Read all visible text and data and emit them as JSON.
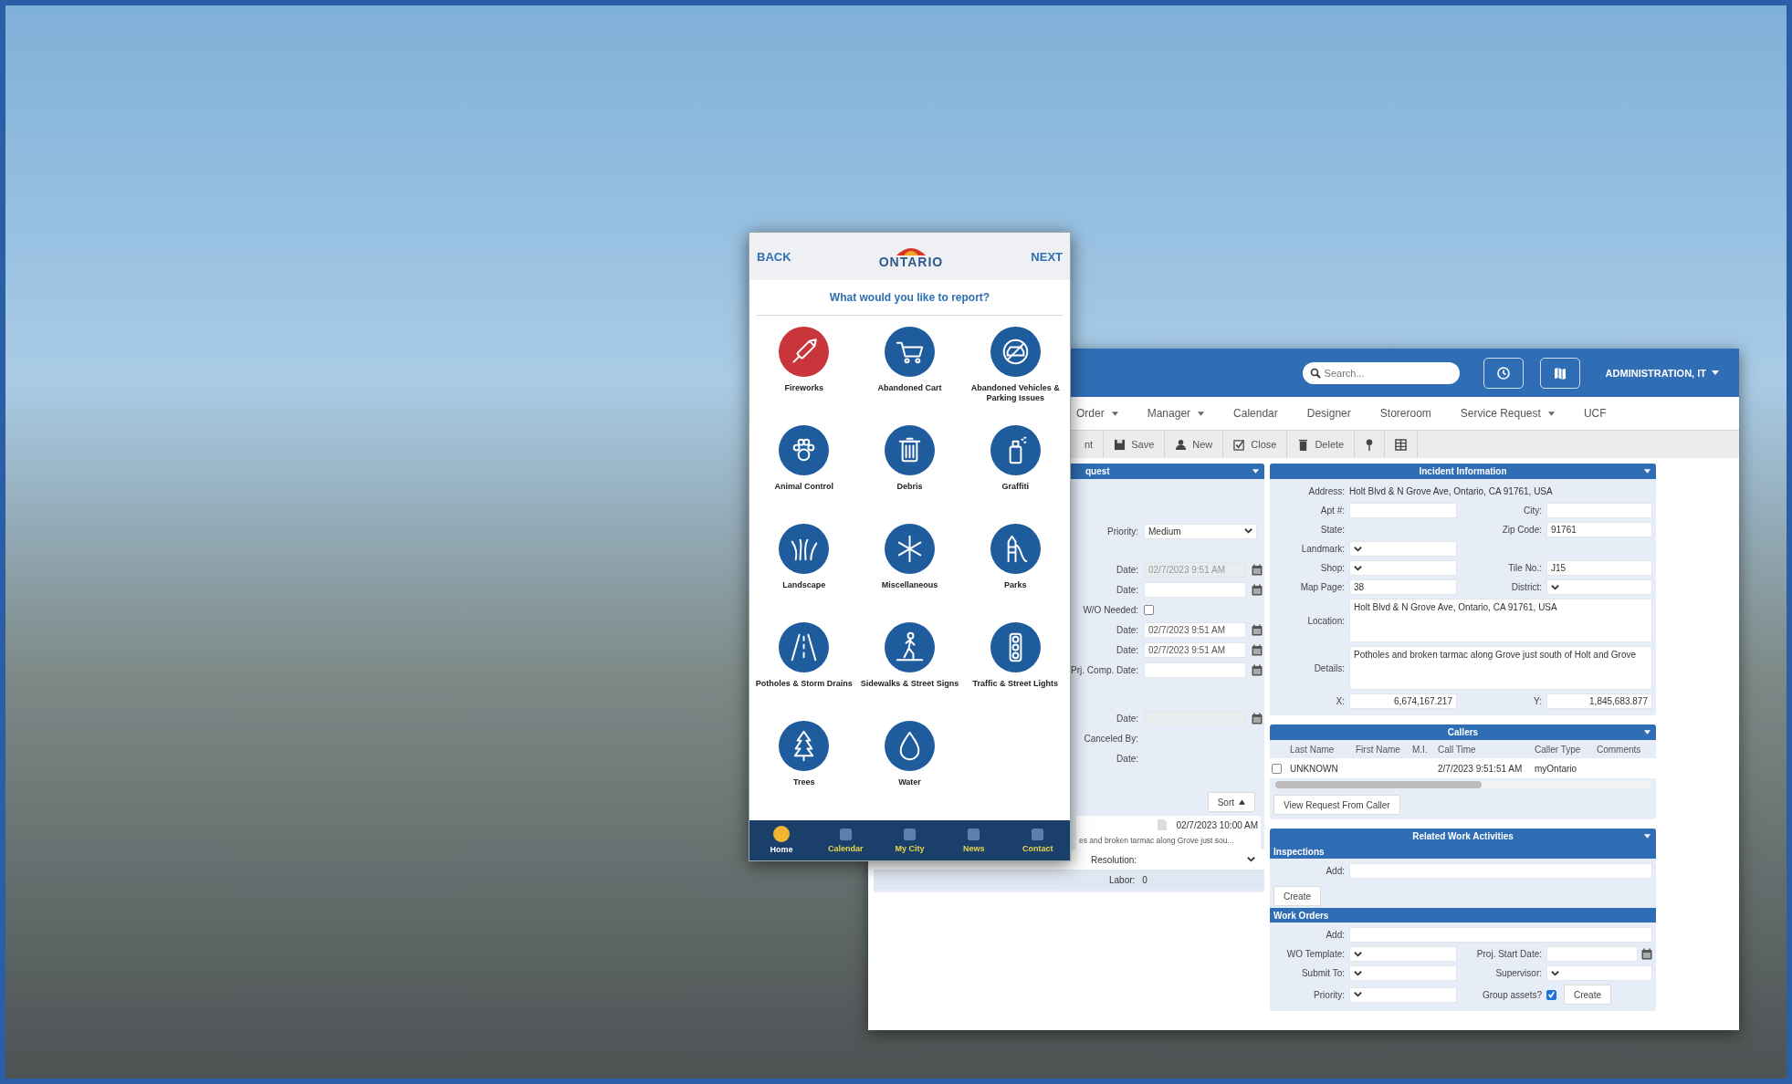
{
  "phone": {
    "back": "BACK",
    "logo": "ONTARIO",
    "next": "NEXT",
    "prompt": "What would you like to report?",
    "categories": [
      {
        "label": "Fireworks",
        "color": "#c8353a"
      },
      {
        "label": "Abandoned Cart",
        "color": "#1f5c9e"
      },
      {
        "label": "Abandoned Vehicles & Parking Issues",
        "color": "#1f5c9e"
      },
      {
        "label": "Animal Control",
        "color": "#1f5c9e"
      },
      {
        "label": "Debris",
        "color": "#1f5c9e"
      },
      {
        "label": "Graffiti",
        "color": "#1f5c9e"
      },
      {
        "label": "Landscape",
        "color": "#1f5c9e"
      },
      {
        "label": "Miscellaneous",
        "color": "#1f5c9e"
      },
      {
        "label": "Parks",
        "color": "#1f5c9e"
      },
      {
        "label": "Potholes & Storm Drains",
        "color": "#1f5c9e"
      },
      {
        "label": "Sidewalks & Street Signs",
        "color": "#1f5c9e"
      },
      {
        "label": "Traffic & Street Lights",
        "color": "#1f5c9e"
      },
      {
        "label": "Trees",
        "color": "#1f5c9e"
      },
      {
        "label": "Water",
        "color": "#1f5c9e"
      }
    ],
    "tabs": [
      {
        "label": "Home",
        "selected": true
      },
      {
        "label": "Calendar",
        "selected": false
      },
      {
        "label": "My City",
        "selected": false
      },
      {
        "label": "News",
        "selected": false
      },
      {
        "label": "Contact",
        "selected": false
      }
    ]
  },
  "app": {
    "search": {
      "placeholder": "Search..."
    },
    "user": "ADMINISTRATION, IT",
    "nav": [
      {
        "label": "Order",
        "dropdown": true
      },
      {
        "label": "Manager",
        "dropdown": true
      },
      {
        "label": "Calendar",
        "dropdown": false
      },
      {
        "label": "Designer",
        "dropdown": false
      },
      {
        "label": "Storeroom",
        "dropdown": false
      },
      {
        "label": "Service Request",
        "dropdown": true
      },
      {
        "label": "UCF",
        "dropdown": false
      }
    ],
    "toolbar": [
      "nt",
      "Save",
      "New",
      "Close",
      "Delete"
    ],
    "request": {
      "title": "quest",
      "groups": [
        [
          {
            "kind": "select",
            "label": "Priority:",
            "value": "Medium"
          }
        ],
        [
          {
            "kind": "date",
            "label": "Date:",
            "value": "02/7/2023 9:51 AM",
            "disabled": true
          },
          {
            "kind": "date",
            "label": "Date:",
            "disabled": false
          },
          {
            "kind": "checkbox",
            "label": "W/O Needed:",
            "checked": false
          },
          {
            "kind": "date",
            "label": "Date:",
            "value": "02/7/2023 9:51 AM",
            "disabled": false
          },
          {
            "kind": "date",
            "label": "Date:",
            "value": "02/7/2023 9:51 AM",
            "disabled": false
          },
          {
            "kind": "date",
            "label": "Prj. Comp. Date:",
            "disabled": false
          }
        ],
        [
          {
            "kind": "date",
            "label": "Date:",
            "disabled": true
          },
          {
            "kind": "text",
            "label": "Canceled By:"
          },
          {
            "kind": "text",
            "label": "Date:"
          }
        ]
      ],
      "sort": "Sort",
      "note": {
        "date": "02/7/2023 10:00 AM",
        "text": "es and broken tarmac along Grove just sou..."
      },
      "resolution": "Resolution:",
      "labor": {
        "label": "Labor:",
        "value": "0"
      }
    },
    "incident": {
      "title": "Incident Information",
      "rows": [
        [
          {
            "kind": "text",
            "label": "Address:",
            "value": "Holt Blvd & N Grove Ave, Ontario, CA 91761, USA"
          }
        ],
        [
          {
            "kind": "input",
            "label": "Apt #:"
          },
          {
            "kind": "input",
            "label": "City:"
          }
        ],
        [
          {
            "kind": "text",
            "label": "State:"
          },
          {
            "kind": "input",
            "label": "Zip Code:",
            "value": "91761"
          }
        ],
        [
          {
            "kind": "select",
            "label": "Landmark:"
          }
        ],
        [
          {
            "kind": "select",
            "label": "Shop:"
          },
          {
            "kind": "input",
            "label": "Tile No.:",
            "value": "J15"
          }
        ],
        [
          {
            "kind": "input",
            "label": "Map Page:",
            "value": "38"
          },
          {
            "kind": "select",
            "label": "District:"
          }
        ],
        [
          {
            "kind": "textarea",
            "label": "Location:",
            "value": "Holt Blvd & N Grove Ave, Ontario, CA 91761, USA"
          }
        ],
        [
          {
            "kind": "textarea",
            "label": "Details:",
            "value": "Potholes and broken tarmac along Grove just south of Holt and Grove"
          }
        ],
        [
          {
            "kind": "number",
            "label": "X:",
            "value": "6,674,167.217"
          },
          {
            "kind": "number",
            "label": "Y:",
            "value": "1,845,683.877"
          }
        ]
      ]
    },
    "callers": {
      "title": "Callers",
      "columns": [
        "Last Name",
        "First Name",
        "M.I.",
        "Call Time",
        "Caller Type",
        "Comments"
      ],
      "rows": [
        {
          "checked": false,
          "cells": [
            "UNKNOWN",
            null,
            null,
            "2/7/2023 9:51:51 AM",
            "myOntario",
            null
          ]
        }
      ],
      "button": "View Request From Caller"
    },
    "related": {
      "title": "Related Work Activities",
      "inspections": {
        "title": "Inspections",
        "add": "Add:",
        "button": "Create"
      },
      "work_orders": {
        "title": "Work Orders",
        "add": "Add:",
        "rows": [
          [
            {
              "kind": "select",
              "label": "WO Template:"
            },
            {
              "kind": "date",
              "label": "Proj. Start Date:"
            }
          ],
          [
            {
              "kind": "select",
              "label": "Submit To:"
            },
            {
              "kind": "select",
              "label": "Supervisor:"
            }
          ],
          [
            {
              "kind": "select",
              "label": "Priority:"
            },
            {
              "kind": "checkbox",
              "label": "Group assets?",
              "checked": true,
              "button": "Create"
            }
          ]
        ]
      }
    }
  }
}
